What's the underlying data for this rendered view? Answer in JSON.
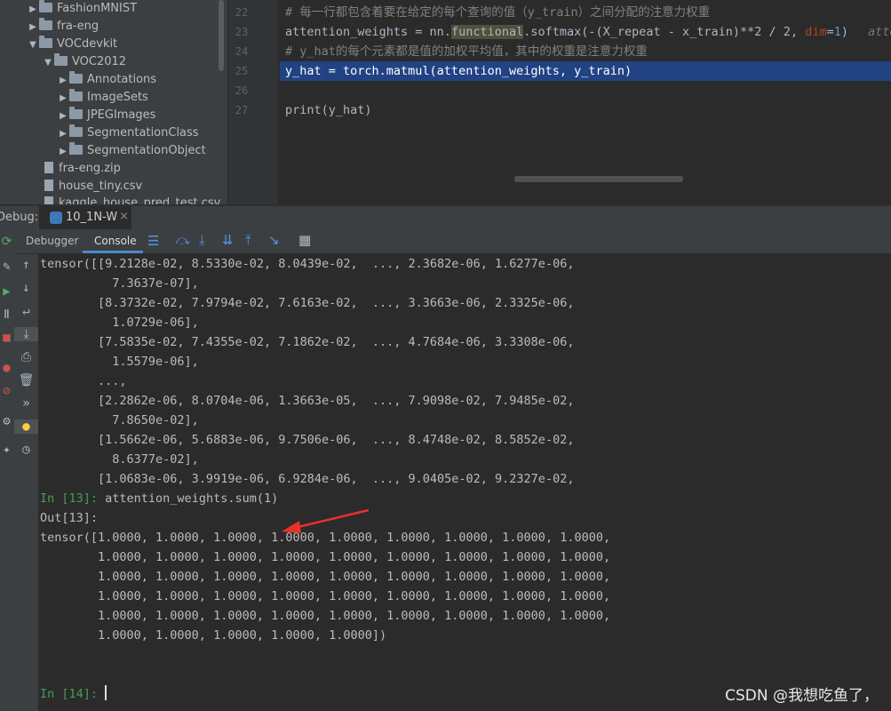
{
  "project_tree": {
    "items": [
      {
        "label": "FashionMNIST",
        "type": "folder",
        "expanded": false,
        "indent": 1
      },
      {
        "label": "fra-eng",
        "type": "folder",
        "expanded": false,
        "indent": 1
      },
      {
        "label": "VOCdevkit",
        "type": "folder",
        "expanded": true,
        "indent": 1
      },
      {
        "label": "VOC2012",
        "type": "folder",
        "expanded": true,
        "indent": 2
      },
      {
        "label": "Annotations",
        "type": "folder",
        "expanded": false,
        "indent": 3
      },
      {
        "label": "ImageSets",
        "type": "folder",
        "expanded": false,
        "indent": 3
      },
      {
        "label": "JPEGImages",
        "type": "folder",
        "expanded": false,
        "indent": 3
      },
      {
        "label": "SegmentationClass",
        "type": "folder",
        "expanded": false,
        "indent": 3
      },
      {
        "label": "SegmentationObject",
        "type": "folder",
        "expanded": false,
        "indent": 3
      },
      {
        "label": "fra-eng.zip",
        "type": "file",
        "indent": 1
      },
      {
        "label": "house_tiny.csv",
        "type": "file",
        "indent": 1
      },
      {
        "label": "kaggle_house_pred_test.csv",
        "type": "file",
        "indent": 1
      }
    ]
  },
  "editor": {
    "lines": [
      {
        "num": "22",
        "text": "# 每一行都包含着要在给定的每个查询的值（y_train）之间分配的注意力权重"
      },
      {
        "num": "23",
        "text": "attention_weights = nn.functional.softmax(-(X_repeat - x_train)**2 / 2, dim=1)"
      },
      {
        "num": "24",
        "text": "# y_hat的每个元素都是值的加权平均值，其中的权重是注意力权重"
      },
      {
        "num": "25",
        "text": "y_hat = torch.matmul(attention_weights, y_train)"
      },
      {
        "num": "26",
        "text": ""
      },
      {
        "num": "27",
        "text": "print(y_hat)"
      }
    ],
    "line23_parts": {
      "a": "attention_weights = nn.",
      "b": "functional",
      ".c": "",
      "c": ".softmax(-(X_repeat - x_train)**2 / 2, ",
      "d": "dim",
      "e": "=",
      "f": "1",
      ")": "",
      ")_": ")",
      "hint": "atten"
    }
  },
  "debug": {
    "label": "Debug:",
    "tab": "10_1N-W"
  },
  "tabs": {
    "debugger": "Debugger",
    "console": "Console"
  },
  "console": {
    "lines": [
      "tensor([[9.2128e-02, 8.5330e-02, 8.0439e-02,  ..., 2.3682e-06, 1.6277e-06,",
      "          7.3637e-07],",
      "        [8.3732e-02, 7.9794e-02, 7.6163e-02,  ..., 3.3663e-06, 2.3325e-06,",
      "          1.0729e-06],",
      "        [7.5835e-02, 7.4355e-02, 7.1862e-02,  ..., 4.7684e-06, 3.3308e-06,",
      "          1.5579e-06],",
      "        ...,",
      "        [2.2862e-06, 8.0704e-06, 1.3663e-05,  ..., 7.9098e-02, 7.9485e-02,",
      "          7.8650e-02],",
      "        [1.5662e-06, 5.6883e-06, 9.7506e-06,  ..., 8.4748e-02, 8.5852e-02,",
      "          8.6377e-02],",
      "        [1.0683e-06, 3.9919e-06, 6.9284e-06,  ..., 9.0405e-02, 9.2327e-02,",
      "          9.4451e-02]])"
    ],
    "in13_prompt": "In [13]: ",
    "in13_code": "attention_weights.sum(1)",
    "out13": "Out[13]:",
    "sum_lines": [
      "tensor([1.0000, 1.0000, 1.0000, 1.0000, 1.0000, 1.0000, 1.0000, 1.0000, 1.0000,",
      "        1.0000, 1.0000, 1.0000, 1.0000, 1.0000, 1.0000, 1.0000, 1.0000, 1.0000,",
      "        1.0000, 1.0000, 1.0000, 1.0000, 1.0000, 1.0000, 1.0000, 1.0000, 1.0000,",
      "        1.0000, 1.0000, 1.0000, 1.0000, 1.0000, 1.0000, 1.0000, 1.0000, 1.0000,",
      "        1.0000, 1.0000, 1.0000, 1.0000, 1.0000, 1.0000, 1.0000, 1.0000, 1.0000,",
      "        1.0000, 1.0000, 1.0000, 1.0000, 1.0000])"
    ],
    "in14_prompt": "In [14]: "
  },
  "watermark": "CSDN @我想吃鱼了，",
  "colors": {
    "arrow": "#e8312a",
    "selection": "#214283",
    "prompt": "#499c54"
  }
}
